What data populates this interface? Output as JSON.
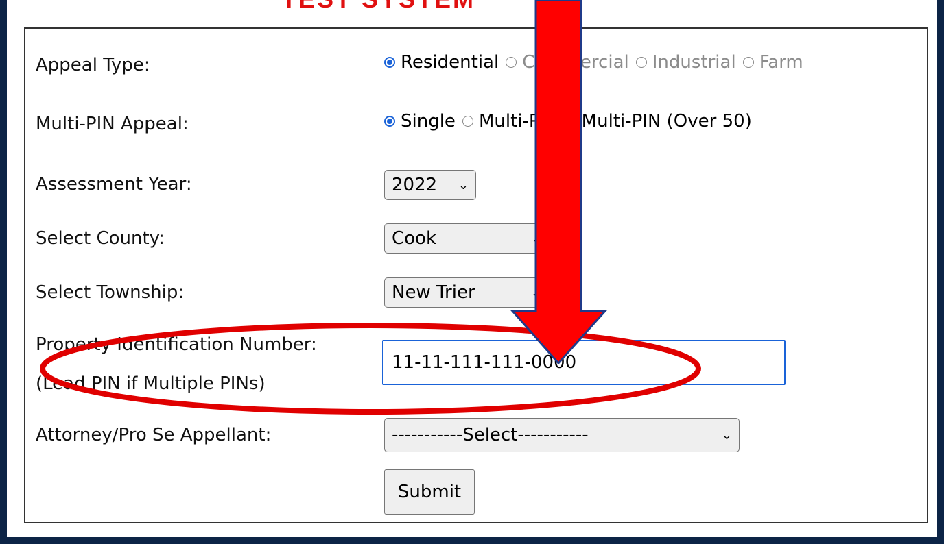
{
  "heading_fragment": "TEST SYSTEM",
  "form": {
    "appeal_type": {
      "label": "Appeal Type:",
      "options": [
        "Residential",
        "Commercial",
        "Industrial",
        "Farm"
      ],
      "selected": "Residential"
    },
    "multi_pin": {
      "label": "Multi-PIN Appeal:",
      "options": [
        "Single",
        "Multi-PIN",
        "Multi-PIN (Over 50)"
      ],
      "selected": "Single"
    },
    "assessment_year": {
      "label": "Assessment Year:",
      "value": "2022"
    },
    "county": {
      "label": "Select County:",
      "value": "Cook"
    },
    "township": {
      "label": "Select Township:",
      "value": "New Trier"
    },
    "pin": {
      "label_line1": "Property Identification Number:",
      "label_line2": "(Lead PIN if Multiple PINs)",
      "value": "11-11-111-111-0000"
    },
    "attorney": {
      "label": "Attorney/Pro Se Appellant:",
      "value": "-----------Select-----------"
    },
    "submit_label": "Submit"
  },
  "annotation_colors": {
    "arrow": "#ff0000",
    "arrow_outline": "#1f3a8a",
    "ellipse": "#e00000"
  }
}
